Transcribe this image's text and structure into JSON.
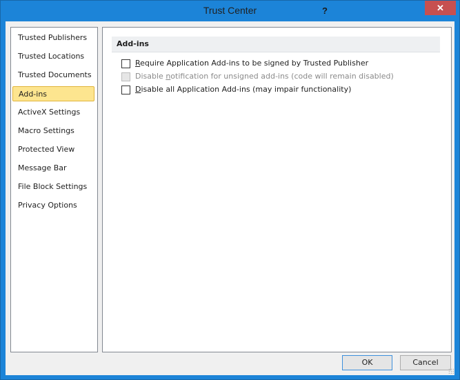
{
  "window": {
    "title": "Trust Center",
    "help_label": "?",
    "close_label": "✕",
    "accent_color": "#1c84d8",
    "close_color": "#c75050"
  },
  "sidebar": {
    "items": [
      {
        "label": "Trusted Publishers",
        "selected": false
      },
      {
        "label": "Trusted Locations",
        "selected": false
      },
      {
        "label": "Trusted Documents",
        "selected": false
      },
      {
        "label": "Add-ins",
        "selected": true
      },
      {
        "label": "ActiveX Settings",
        "selected": false
      },
      {
        "label": "Macro Settings",
        "selected": false
      },
      {
        "label": "Protected View",
        "selected": false
      },
      {
        "label": "Message Bar",
        "selected": false
      },
      {
        "label": "File Block Settings",
        "selected": false
      },
      {
        "label": "Privacy Options",
        "selected": false
      }
    ]
  },
  "main": {
    "section_title": "Add-ins",
    "options": [
      {
        "label": "Require Application Add-ins to be signed by Trusted Publisher",
        "accesskey": "R",
        "checked": false,
        "disabled": false
      },
      {
        "label": "Disable notification for unsigned add-ins (code will remain disabled)",
        "accesskey": "n",
        "checked": false,
        "disabled": true
      },
      {
        "label": "Disable all Application Add-ins (may impair functionality)",
        "accesskey": "D",
        "checked": false,
        "disabled": false
      }
    ]
  },
  "footer": {
    "ok_label": "OK",
    "cancel_label": "Cancel"
  }
}
